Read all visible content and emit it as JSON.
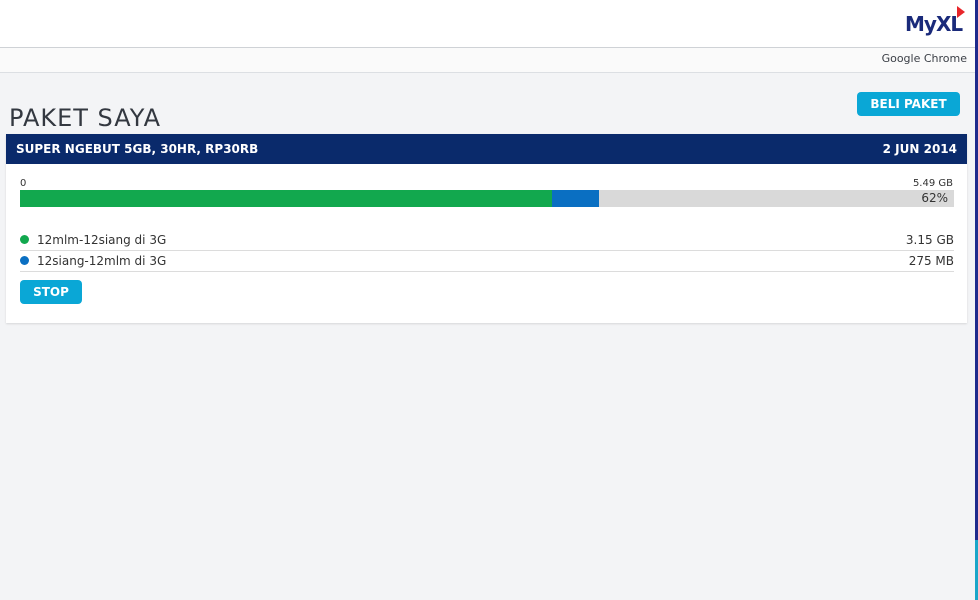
{
  "header": {
    "logo_text": "MyXL",
    "browser_label": "Google Chrome"
  },
  "page": {
    "title": "PAKET SAYA",
    "buy_button_label": "BELI PAKET"
  },
  "package": {
    "name": "SUPER NGEBUT 5GB, 30HR, RP30RB",
    "date": "2 JUN 2014",
    "scale_min": "0",
    "scale_max": "5.49 GB",
    "usage_percent_label": "62%",
    "usage_fraction_total": 0.62,
    "usage_fraction_green": 0.57,
    "usage": [
      {
        "label": "12mlm-12siang di 3G",
        "value": "3.15 GB",
        "color": "#12a84e"
      },
      {
        "label": "12siang-12mlm di 3G",
        "value": "275 MB",
        "color": "#0a6fc2"
      }
    ],
    "stop_button_label": "STOP"
  },
  "colors": {
    "header_bg": "#0a2a6b",
    "accent": "#0aa7d6",
    "green": "#12a84e",
    "blue": "#0a6fc2"
  }
}
